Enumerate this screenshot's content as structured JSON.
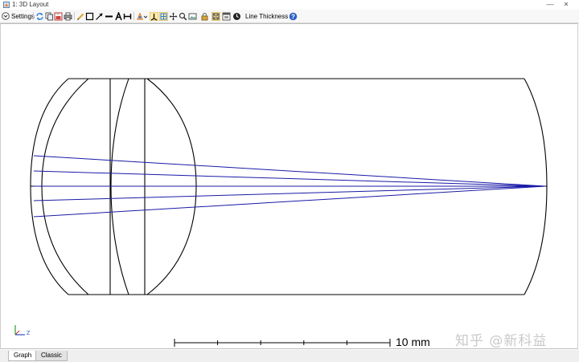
{
  "window": {
    "title": "1: 3D Layout"
  },
  "toolbar": {
    "settings_label": "Settings",
    "line_thickness_label": "Line Thickness"
  },
  "tabs": [
    {
      "label": "Graph"
    },
    {
      "label": "Classic"
    }
  ],
  "plot": {
    "scale_label": "10 mm",
    "axis_label": "Z"
  },
  "watermark": {
    "text": "知乎 @新科益"
  },
  "colors": {
    "lens_outline": "#000000",
    "ray": "#1a1aa8"
  }
}
